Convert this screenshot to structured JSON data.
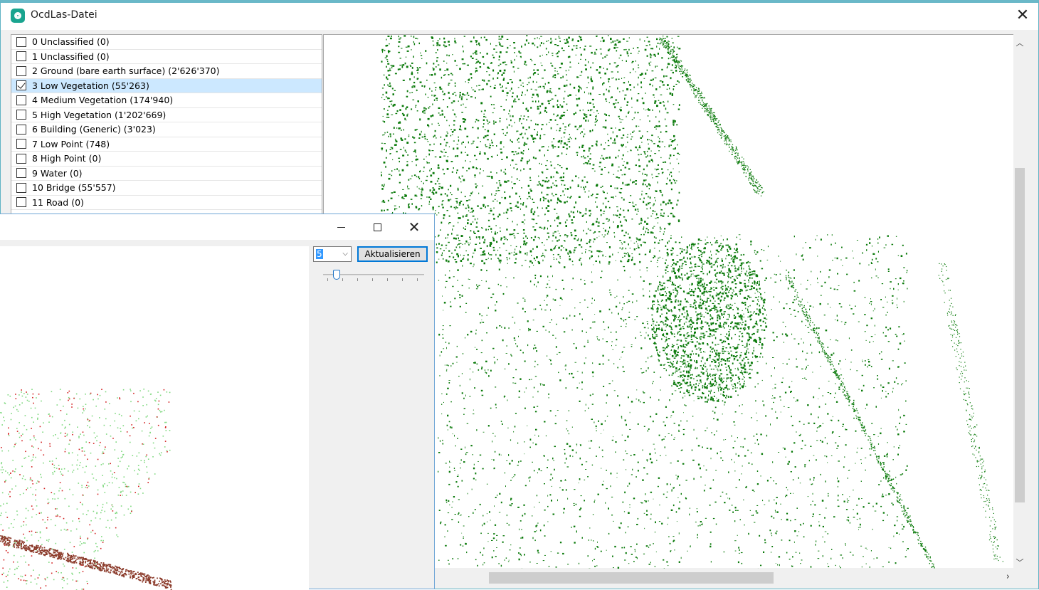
{
  "main_window": {
    "title": "OcdLas-Datei",
    "close_label": "✕"
  },
  "classes": [
    {
      "label": "0 Unclassified (0)",
      "checked": false
    },
    {
      "label": "1 Unclassified (0)",
      "checked": false
    },
    {
      "label": "2 Ground (bare earth surface) (2'626'370)",
      "checked": false
    },
    {
      "label": "3 Low Vegetation (55'263)",
      "checked": true
    },
    {
      "label": "4 Medium Vegetation (174'940)",
      "checked": false
    },
    {
      "label": "5 High Vegetation (1'202'669)",
      "checked": false
    },
    {
      "label": "6 Building (Generic) (3'023)",
      "checked": false
    },
    {
      "label": "7 Low Point (748)",
      "checked": false
    },
    {
      "label": "8 High Point (0)",
      "checked": false
    },
    {
      "label": "9 Water (0)",
      "checked": false
    },
    {
      "label": "10 Bridge (55'557)",
      "checked": false
    },
    {
      "label": "11 Road (0)",
      "checked": false
    }
  ],
  "profile_window": {
    "width_value": "5",
    "update_label": "Aktualisieren",
    "slider_value": 0.1,
    "close_label": "✕"
  },
  "colors": {
    "vegetation_points": "#0a7a0a",
    "profile_ground": "#8b3a2a",
    "profile_veg": "#7ed87e",
    "profile_red": "#d22020"
  }
}
